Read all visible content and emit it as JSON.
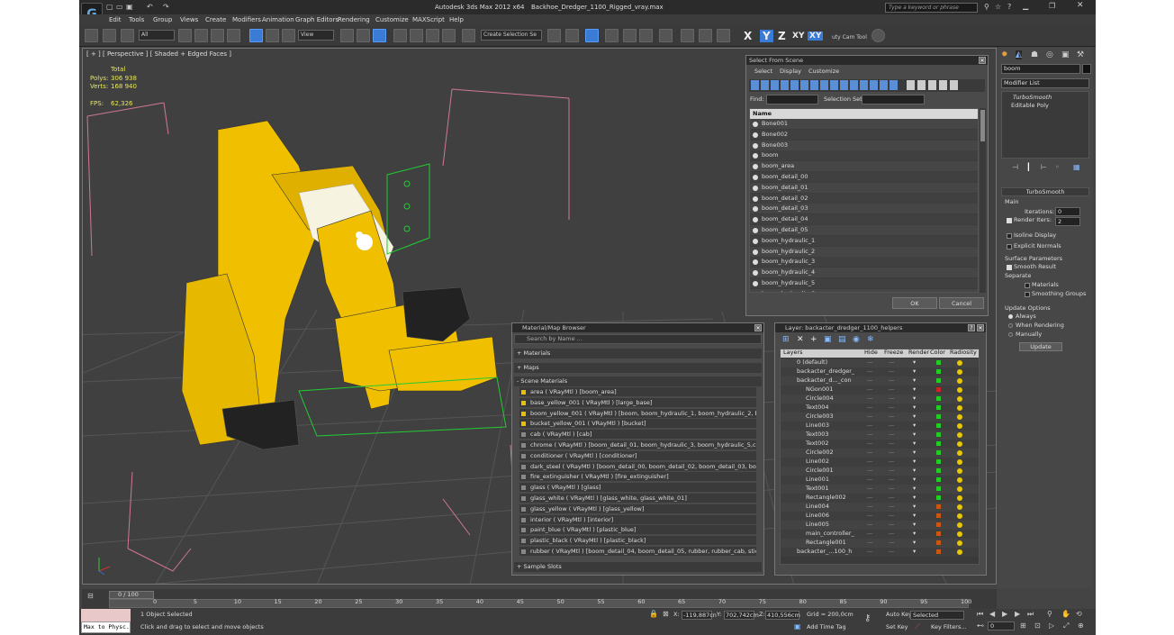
{
  "title": {
    "app": "Autodesk 3ds Max  2012 x64",
    "file": "Backhoe_Dredger_1100_Rigged_vray.max",
    "search_placeholder": "Type a keyword or phrase"
  },
  "menu": [
    "Edit",
    "Tools",
    "Group",
    "Views",
    "Create",
    "Modifiers",
    "Animation",
    "Graph Editors",
    "Rendering",
    "Customize",
    "MAXScript",
    "Help"
  ],
  "toolbar": {
    "filter": "All",
    "refcoord": "View",
    "selection_set": "Create Selection Se",
    "x": "X",
    "y": "Y",
    "z": "Z",
    "xy": "XY",
    "xy2": "XY",
    "tool_label": "uty Cam Tool"
  },
  "viewport": {
    "label": "[ + ] [ Perspective ] [ Shaded + Edged Faces ]",
    "total": "Total",
    "polys_label": "Polys:",
    "polys": "306 938",
    "verts_label": "Verts:",
    "verts": "168 940",
    "fps_label": "FPS:",
    "fps": "62,326"
  },
  "select_from_scene": {
    "title": "Select From Scene",
    "tabs": [
      "Select",
      "Display",
      "Customize"
    ],
    "find_label": "Find:",
    "selection_set_label": "Selection Set:",
    "column": "Name",
    "items": [
      "Bone001",
      "Bone002",
      "Bone003",
      "boom",
      "boom_area",
      "boom_detail_00",
      "boom_detail_01",
      "boom_detail_02",
      "boom_detail_03",
      "boom_detail_04",
      "boom_detail_05",
      "boom_hydraulic_1",
      "boom_hydraulic_2",
      "boom_hydraulic_3",
      "boom_hydraulic_4",
      "boom_hydraulic_5",
      "boom_hydraulic_6"
    ],
    "ok": "OK",
    "cancel": "Cancel"
  },
  "material_browser": {
    "title": "Material/Map Browser",
    "search_placeholder": "Search by Name ...",
    "sections": [
      "+ Materials",
      "+ Maps",
      "- Scene Materials"
    ],
    "items": [
      "area  ( VRayMtl ) [boom_area]",
      "base_yellow_001  ( VRayMtl ) [large_base]",
      "boom_yellow_001  ( VRayMtl ) [boom, boom_hydraulic_1, boom_hydraulic_2, b...",
      "bucket_yellow_001  ( VRayMtl ) [bucket]",
      "cab  ( VRayMtl ) [cab]",
      "chrome  ( VRayMtl ) [boom_detail_01, boom_hydraulic_3, boom_hydraulic_5,ca...",
      "conditioner  ( VRayMtl ) [conditioner]",
      "dark_steel  ( VRayMtl ) [boom_detail_00, boom_detail_02, boom_detail_03, boo...",
      "fire_extinguisher  ( VRayMtl ) [fire_extinguisher]",
      "glass  ( VRayMtl ) [glass]",
      "glass_white  ( VRayMtl ) [glass_white, glass_white_01]",
      "glass_yellow  ( VRayMtl ) [glass_yellow]",
      "interior  ( VRayMtl ) [interior]",
      "paint_blue  ( VRayMtl ) [plastic_blue]",
      "plastic_black  ( VRayMtl ) [plastic_black]",
      "rubber  ( VRayMtl ) [boom_detail_04, boom_detail_05, rubber, rubber_cab, stick..."
    ],
    "sample_slots": "+ Sample Slots"
  },
  "layer_manager": {
    "title": "Layer: backacter_dredger_1100_helpers",
    "columns": [
      "Layers",
      "Hide",
      "Freeze",
      "Render",
      "Color",
      "Radiosity"
    ],
    "rows": [
      {
        "name": "0 (default)",
        "color": "#22cc22"
      },
      {
        "name": "backacter_dredger_",
        "color": "#22cc22"
      },
      {
        "name": "backacter_d..._con",
        "color": "#22cc22"
      },
      {
        "name": "NGon001",
        "color": "#cc2222"
      },
      {
        "name": "Circle004",
        "color": "#22cc22"
      },
      {
        "name": "Text004",
        "color": "#22cc22"
      },
      {
        "name": "Circle003",
        "color": "#22cc22"
      },
      {
        "name": "Line003",
        "color": "#22cc22"
      },
      {
        "name": "Text003",
        "color": "#22cc22"
      },
      {
        "name": "Text002",
        "color": "#22cc22"
      },
      {
        "name": "Circle002",
        "color": "#22cc22"
      },
      {
        "name": "Line002",
        "color": "#22cc22"
      },
      {
        "name": "Circle001",
        "color": "#22cc22"
      },
      {
        "name": "Line001",
        "color": "#22cc22"
      },
      {
        "name": "Text001",
        "color": "#22cc22"
      },
      {
        "name": "Rectangle002",
        "color": "#22cc22"
      },
      {
        "name": "Line004",
        "color": "#cc5511"
      },
      {
        "name": "Line006",
        "color": "#cc5511"
      },
      {
        "name": "Line005",
        "color": "#cc5511"
      },
      {
        "name": "main_controller_",
        "color": "#cc5511"
      },
      {
        "name": "Rectangle001",
        "color": "#cc5511"
      },
      {
        "name": "backacter_...100_h",
        "color": "#cc5511"
      }
    ]
  },
  "command_panel": {
    "object_name": "boom",
    "modifier_list": "Modifier List",
    "stack": [
      "TurboSmooth",
      "Editable Poly"
    ],
    "rollout_title": "TurboSmooth",
    "main_label": "Main",
    "iterations_label": "Iterations:",
    "iterations": "0",
    "render_iters_label": "Render Iters:",
    "render_iters": "2",
    "isoline": "Isoline Display",
    "explicit": "Explicit Normals",
    "surface_params": "Surface Parameters",
    "smooth_result": "Smooth Result",
    "separate": "Separate",
    "materials": "Materials",
    "smoothing_groups": "Smoothing Groups",
    "update_options": "Update Options",
    "always": "Always",
    "when_rendering": "When Rendering",
    "manually": "Manually",
    "update": "Update"
  },
  "timeline": {
    "frame": "0 / 100",
    "ticks": [
      "0",
      "5",
      "10",
      "15",
      "20",
      "25",
      "30",
      "35",
      "40",
      "45",
      "50",
      "55",
      "60",
      "65",
      "70",
      "75",
      "80",
      "85",
      "90",
      "95",
      "100"
    ]
  },
  "status": {
    "maxscript": "Max to Physc.",
    "objects_selected": "1 Object Selected",
    "prompt": "Click and drag to select and move objects",
    "x_label": "X:",
    "x": "-119,887cn",
    "y_label": "Y:",
    "y": "702,742cm",
    "z_label": "Z:",
    "z": "410,556cm",
    "grid": "Grid = 200,0cm",
    "auto_key": "Auto Key",
    "set_key": "Set Key",
    "selected": "Selected",
    "key_filters": "Key Filters...",
    "add_time_tag": "Add Time Tag",
    "frame_field": "0"
  }
}
